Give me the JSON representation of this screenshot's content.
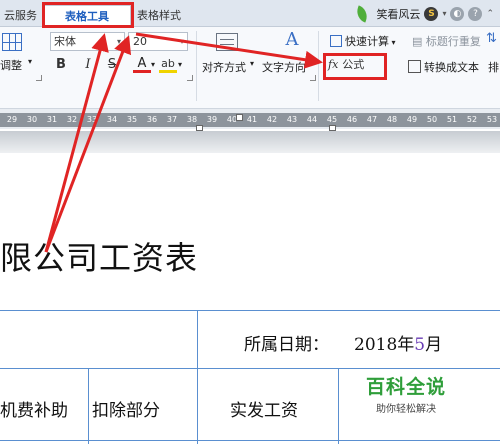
{
  "tabs": {
    "cloud": "云服务",
    "table_tools": "表格工具",
    "table_style": "表格样式"
  },
  "user": {
    "name": "笑看风云",
    "coin_glyph": "S",
    "icon": "leaf-icon"
  },
  "ribbon": {
    "adjust_label": "调整",
    "font_name": "宋体",
    "font_size": "20",
    "bold": "B",
    "italic": "I",
    "strike": "S",
    "font_color": "A",
    "highlight": "ab",
    "align_label": "对齐方式",
    "text_dir_label": "文字方向",
    "text_dir_glyph": "A",
    "quick_calc": "快速计算",
    "header_repeat": "标题行重复",
    "formula_fx": "fx",
    "formula_label": "公式",
    "convert_text": "转换成文本",
    "sort_partial": "排"
  },
  "ruler": {
    "ticks": [
      "29",
      "30",
      "31",
      "32",
      "33",
      "34",
      "35",
      "36",
      "37",
      "38",
      "39",
      "40",
      "41",
      "42",
      "43",
      "44",
      "45",
      "46",
      "47",
      "48",
      "49",
      "50",
      "51",
      "52",
      "53"
    ]
  },
  "document": {
    "title": "限公司工资表",
    "date_label": "所属日期：",
    "date_value_prefix": "2018年",
    "date_month": "5",
    "date_suffix": "月",
    "col_phone": "机费补助",
    "col_deduct": "扣除部分",
    "col_actual": "实发工资"
  },
  "watermark": {
    "title": "百科全说",
    "subtitle": "助你轻松解决"
  },
  "colors": {
    "accent_blue": "#1f5fbf",
    "annotation_red": "#e02424",
    "table_line": "#5a8fd0",
    "watermark_green": "#2f9e3a"
  }
}
